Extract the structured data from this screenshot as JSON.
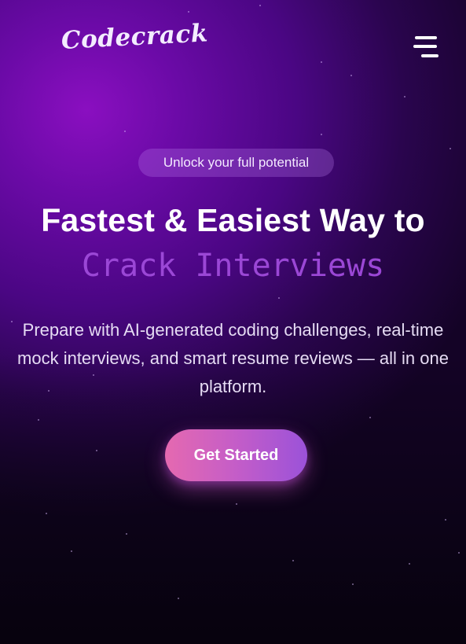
{
  "header": {
    "logo_text": "Codecrack",
    "menu_icon": "hamburger-menu-icon"
  },
  "hero": {
    "badge": "Unlock your full potential",
    "headline": "Fastest & Easiest Way to",
    "headline_accent": "Crack Interviews",
    "description": "Prepare with AI-generated coding challenges, real-time mock interviews, and smart resume reviews — all in one platform.",
    "cta_label": "Get Started"
  },
  "colors": {
    "background_glow": "#8a0fc0",
    "background_dark": "#0d0519",
    "accent_text": "#9b47d6",
    "cta_gradient_start": "#e569b0",
    "cta_gradient_end": "#9b52d9",
    "badge_bg": "#7a3aa8"
  }
}
